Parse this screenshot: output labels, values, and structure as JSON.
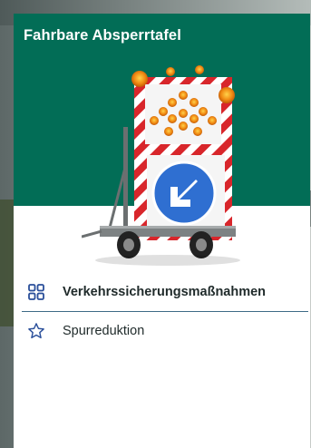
{
  "card": {
    "title": "Fahrbare Absperrtafel"
  },
  "menu": {
    "items": [
      {
        "label": "Verkehrssicherungsmaßnahmen",
        "icon": "grid-icon",
        "active": true
      },
      {
        "label": "Spurreduktion",
        "icon": "star-icon",
        "active": false
      }
    ]
  },
  "colors": {
    "header": "#026d56",
    "icon": "#2a4f9a",
    "divider": "#3e6b86"
  }
}
